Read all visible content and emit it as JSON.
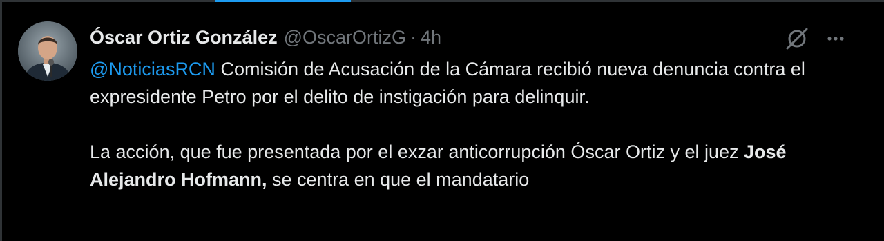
{
  "tweet": {
    "author_name": "Óscar Ortiz González",
    "handle": "@OscarOrtizG",
    "separator": "·",
    "time": "4h",
    "mention": "@NoticiasRCN",
    "paragraph1_rest": " Comisión de Acusación de la Cámara recibió nueva denuncia contra el expresidente Petro por el delito de instigación para delinquir.",
    "paragraph2_start": "La acción, que fue presentada por el exzar anticorrupción Óscar Ortiz y el juez ",
    "paragraph2_bold": "José Alejandro Hofmann,",
    "paragraph2_end": " se centra en que el mandatario"
  },
  "icons": {
    "grok": "grok-icon",
    "more": "more-icon",
    "avatar": "avatar"
  },
  "colors": {
    "background": "#000000",
    "text": "#e7e9ea",
    "muted": "#71767b",
    "accent": "#1d9bf0",
    "border": "#2f3336"
  }
}
